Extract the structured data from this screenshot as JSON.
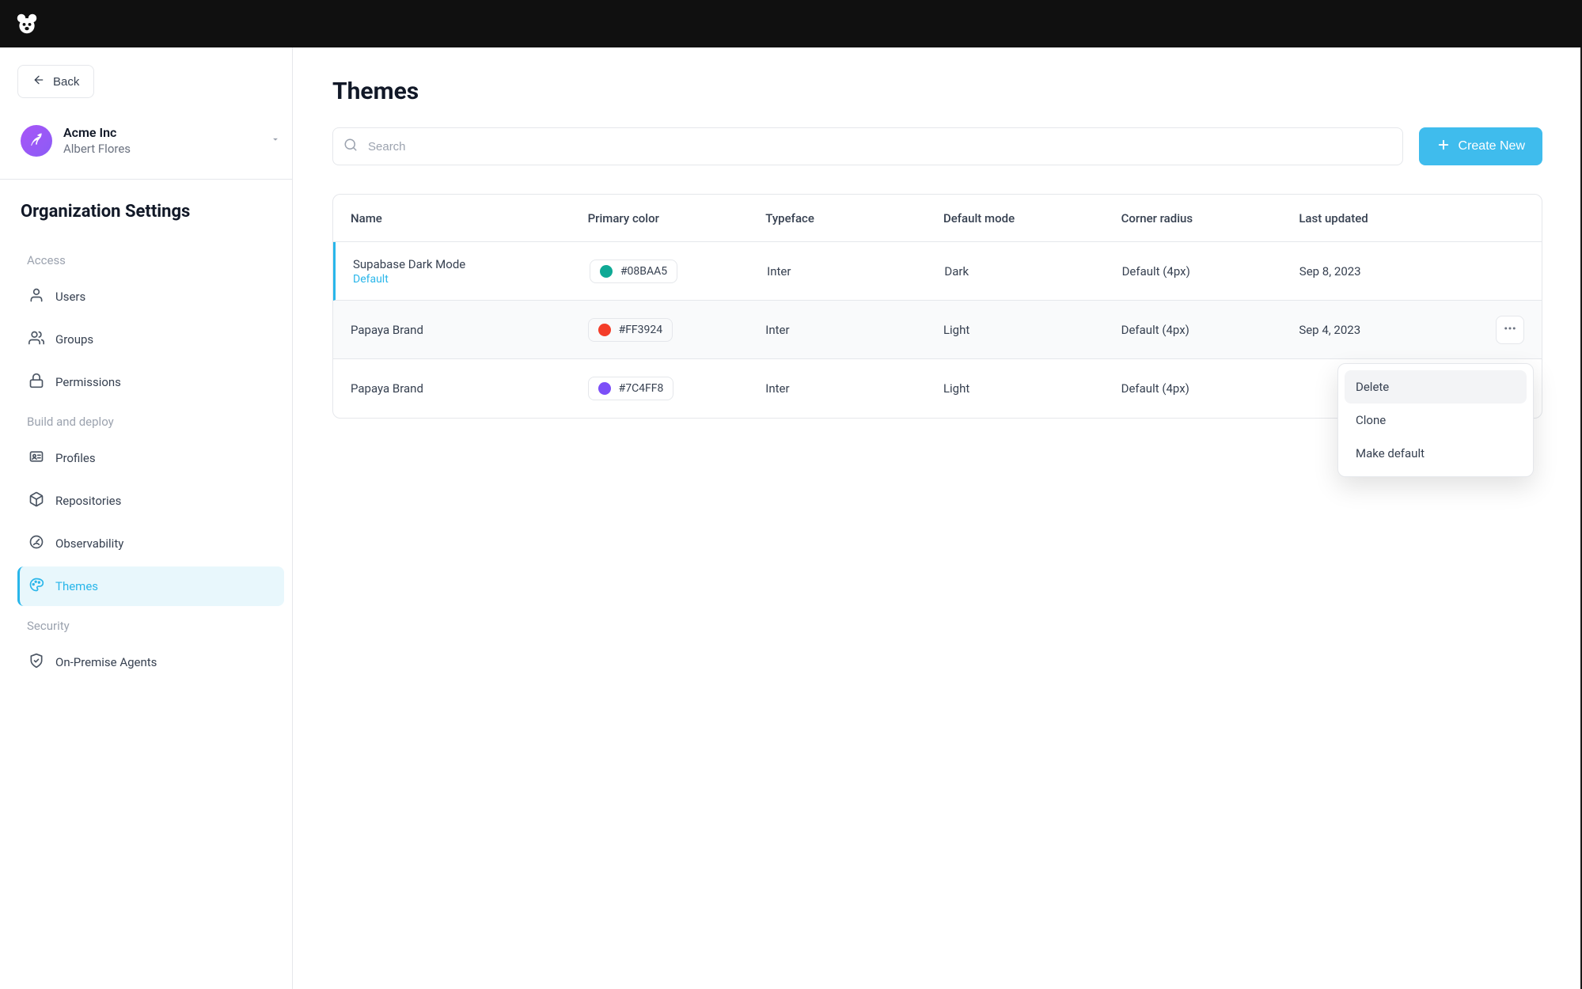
{
  "back_label": "Back",
  "org": {
    "name": "Acme Inc",
    "user": "Albert Flores"
  },
  "section_title": "Organization Settings",
  "groups": {
    "access": {
      "label": "Access",
      "items": {
        "users": "Users",
        "groups": "Groups",
        "permissions": "Permissions"
      }
    },
    "build": {
      "label": "Build and deploy",
      "items": {
        "profiles": "Profiles",
        "repositories": "Repositories",
        "observability": "Observability",
        "themes": "Themes"
      }
    },
    "security": {
      "label": "Security",
      "items": {
        "agents": "On-Premise Agents"
      }
    }
  },
  "page": {
    "title": "Themes",
    "search_placeholder": "Search",
    "create_label": "Create New",
    "columns": {
      "name": "Name",
      "primary_color": "Primary color",
      "typeface": "Typeface",
      "default_mode": "Default mode",
      "corner_radius": "Corner radius",
      "last_updated": "Last updated"
    },
    "rows": [
      {
        "name": "Supabase Dark Mode",
        "badge": "Default",
        "color_hex": "#08BAA5",
        "swatch": "#0fa995",
        "typeface": "Inter",
        "mode": "Dark",
        "radius": "Default (4px)",
        "updated": "Sep 8, 2023"
      },
      {
        "name": "Papaya Brand",
        "badge": "",
        "color_hex": "#FF3924",
        "swatch": "#f43d29",
        "typeface": "Inter",
        "mode": "Light",
        "radius": "Default (4px)",
        "updated": "Sep 4, 2023"
      },
      {
        "name": "Papaya Brand",
        "badge": "",
        "color_hex": "#7C4FF8",
        "swatch": "#7c4ff8",
        "typeface": "Inter",
        "mode": "Light",
        "radius": "Default (4px)",
        "updated": ""
      }
    ],
    "dropdown": {
      "delete": "Delete",
      "clone": "Clone",
      "make_default": "Make default"
    }
  }
}
